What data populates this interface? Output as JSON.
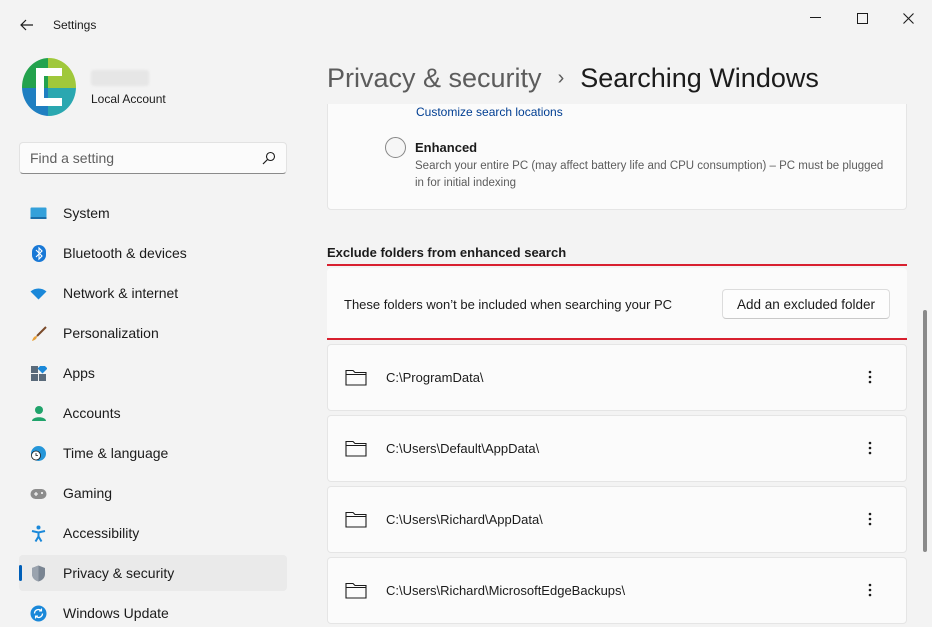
{
  "window": {
    "app_title": "Settings",
    "back_icon": "arrow-left-icon",
    "controls": {
      "minimize": "minimize-icon",
      "maximize": "maximize-icon",
      "close": "close-icon"
    }
  },
  "profile": {
    "account_type": "Local Account",
    "avatar_icon": "user-avatar-logo"
  },
  "search": {
    "placeholder": "Find a setting",
    "value": "",
    "icon": "search-icon"
  },
  "sidebar": {
    "items": [
      {
        "label": "System",
        "icon": "system-icon",
        "active": false
      },
      {
        "label": "Bluetooth & devices",
        "icon": "bluetooth-icon",
        "active": false
      },
      {
        "label": "Network & internet",
        "icon": "network-icon",
        "active": false
      },
      {
        "label": "Personalization",
        "icon": "brush-icon",
        "active": false
      },
      {
        "label": "Apps",
        "icon": "apps-icon",
        "active": false
      },
      {
        "label": "Accounts",
        "icon": "accounts-icon",
        "active": false
      },
      {
        "label": "Time & language",
        "icon": "clock-globe-icon",
        "active": false
      },
      {
        "label": "Gaming",
        "icon": "gamepad-icon",
        "active": false
      },
      {
        "label": "Accessibility",
        "icon": "accessibility-icon",
        "active": false
      },
      {
        "label": "Privacy & security",
        "icon": "shield-icon",
        "active": true
      },
      {
        "label": "Windows Update",
        "icon": "update-icon",
        "active": false
      }
    ]
  },
  "breadcrumb": {
    "parent": "Privacy & security",
    "separator": "›",
    "current": "Searching Windows"
  },
  "find_files": {
    "customize_link": "Customize search locations",
    "enhanced_title": "Enhanced",
    "enhanced_description": "Search your entire PC (may affect battery life and CPU consumption) – PC must be plugged in for initial indexing",
    "enhanced_selected": false
  },
  "exclude": {
    "section_title": "Exclude folders from enhanced search",
    "description": "These folders won’t be included when searching your PC",
    "add_button": "Add an excluded folder",
    "folders": [
      {
        "path": "C:\\ProgramData\\"
      },
      {
        "path": "C:\\Users\\Default\\AppData\\"
      },
      {
        "path": "C:\\Users\\Richard\\AppData\\"
      },
      {
        "path": "C:\\Users\\Richard\\MicrosoftEdgeBackups\\"
      }
    ]
  },
  "colors": {
    "accent": "#005fb8",
    "highlight_border": "#d8202f",
    "link": "#003e92"
  }
}
